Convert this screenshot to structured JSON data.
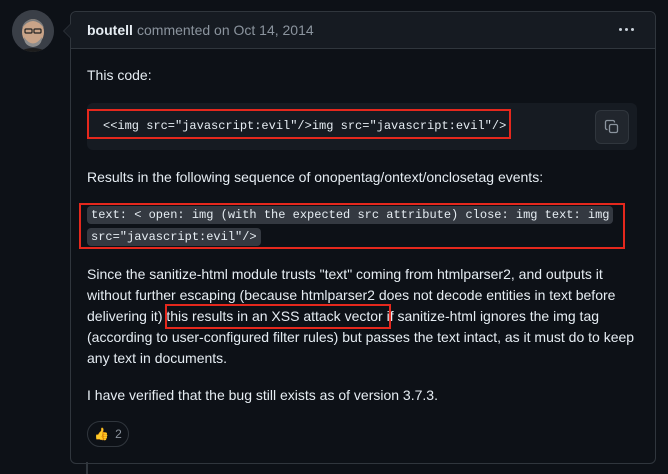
{
  "comment": {
    "author": "boutell",
    "meta": "commented on Oct 14, 2014",
    "intro": "This code:",
    "code_block": "<<img src=\"javascript:evil\"/>img src=\"javascript:evil\"/>",
    "sequence_intro": "Results in the following sequence of onopentag/ontext/onclosetag events:",
    "sequence_line1": "text: < open: img (with the expected src attribute) close: img text: img",
    "sequence_line2": "src=\"javascript:evil\"/>",
    "explanation_before": "Since the sanitize-html module trusts \"text\" coming from htmlparser2, and outputs it without further escaping (because htmlparser2 does not decode entities in text before delivering it) ",
    "explanation_highlight": "this results in an XSS attack vector",
    "explanation_after": " if sanitize-html ignores the img tag (according to user-configured filter rules) but passes the text intact, as it must do to keep any text in documents.",
    "verified": "I have verified that the bug still exists as of version 3.7.3.",
    "reaction": {
      "emoji": "👍",
      "count": "2"
    }
  },
  "colors": {
    "background": "#0d1117",
    "header": "#161b22",
    "border": "#30363d",
    "highlight_box": "#e5281d",
    "muted_text": "#8b949e"
  },
  "icons": [
    "avatar",
    "kebab-menu-icon",
    "copy-icon",
    "thumbs-up-emoji"
  ]
}
